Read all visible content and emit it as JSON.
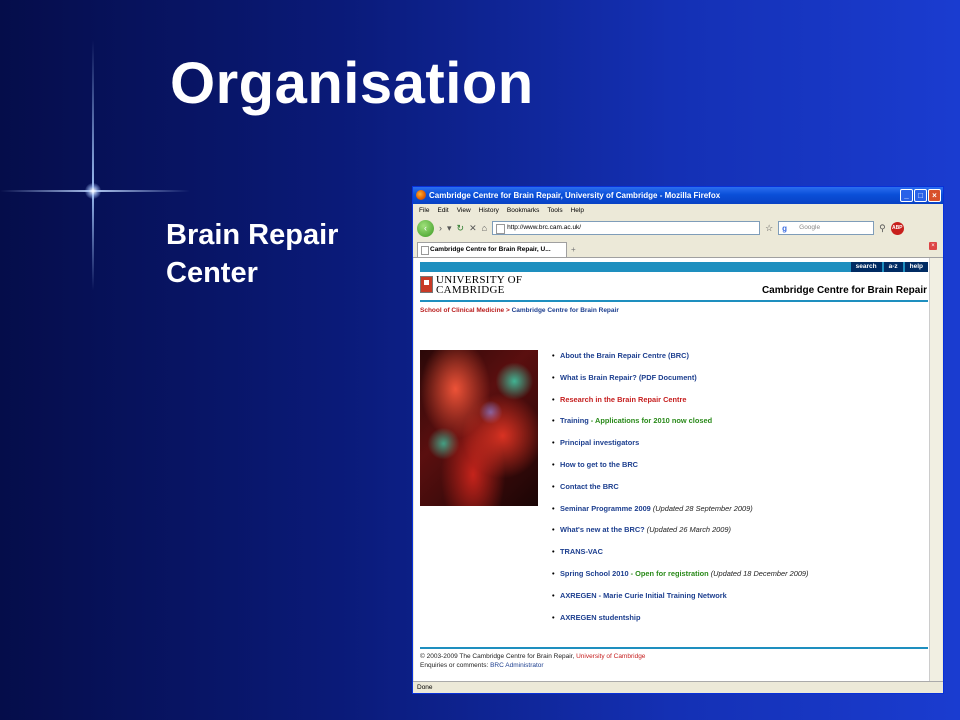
{
  "slide": {
    "title": "Organisation",
    "subtitle_line1": "Brain Repair",
    "subtitle_line2": "Center"
  },
  "browser": {
    "window_title": "Cambridge Centre for Brain Repair, University of Cambridge - Mozilla Firefox",
    "menu": [
      "File",
      "Edit",
      "View",
      "History",
      "Bookmarks",
      "Tools",
      "Help"
    ],
    "url": "http://www.brc.cam.ac.uk/",
    "search_placeholder": "Google",
    "tab_label": "Cambridge Centre for Brain Repair, U...",
    "status": "Done"
  },
  "page": {
    "top_links": [
      "search",
      "a-z",
      "help"
    ],
    "university_line1": "UNIVERSITY OF",
    "university_line2": "CAMBRIDGE",
    "site_title": "Cambridge Centre for Brain Repair",
    "breadcrumb_parent": "School of Clinical Medicine",
    "breadcrumb_sep": " > ",
    "breadcrumb_current": "Cambridge Centre for Brain Repair",
    "links": [
      {
        "text": "About the Brain Repair Centre (BRC)",
        "extra": "",
        "note": ""
      },
      {
        "text": "What is Brain Repair? (PDF Document)",
        "extra": "",
        "note": ""
      },
      {
        "text": "Research in the Brain Repair Centre",
        "extra": "",
        "note": ""
      },
      {
        "text": "Training",
        "extra": " - Applications for 2010 now closed",
        "note": ""
      },
      {
        "text": "Principal investigators",
        "extra": "",
        "note": ""
      },
      {
        "text": "How to get to the BRC",
        "extra": "",
        "note": ""
      },
      {
        "text": "Contact the BRC",
        "extra": "",
        "note": ""
      },
      {
        "text": "Seminar Programme 2009",
        "extra": "",
        "note": " (Updated 28 September 2009)"
      },
      {
        "text": "What's new at the BRC?",
        "extra": "",
        "note": " (Updated 26 March 2009)"
      },
      {
        "text": "TRANS-VAC",
        "extra": "",
        "note": ""
      },
      {
        "text": "Spring School 2010",
        "extra": " - Open for registration",
        "note": " (Updated 18 December 2009)"
      },
      {
        "text": "AXREGEN - Marie Curie Initial Training Network",
        "extra": "",
        "note": ""
      },
      {
        "text": "AXREGEN studentship",
        "extra": "",
        "note": ""
      }
    ],
    "footer_copyright": "© 2003-2009 The Cambridge Centre for Brain Repair, ",
    "footer_copyright_link": "University of Cambridge",
    "footer_enquiries": "Enquiries or comments: ",
    "footer_enquiries_link": "BRC Administrator"
  }
}
